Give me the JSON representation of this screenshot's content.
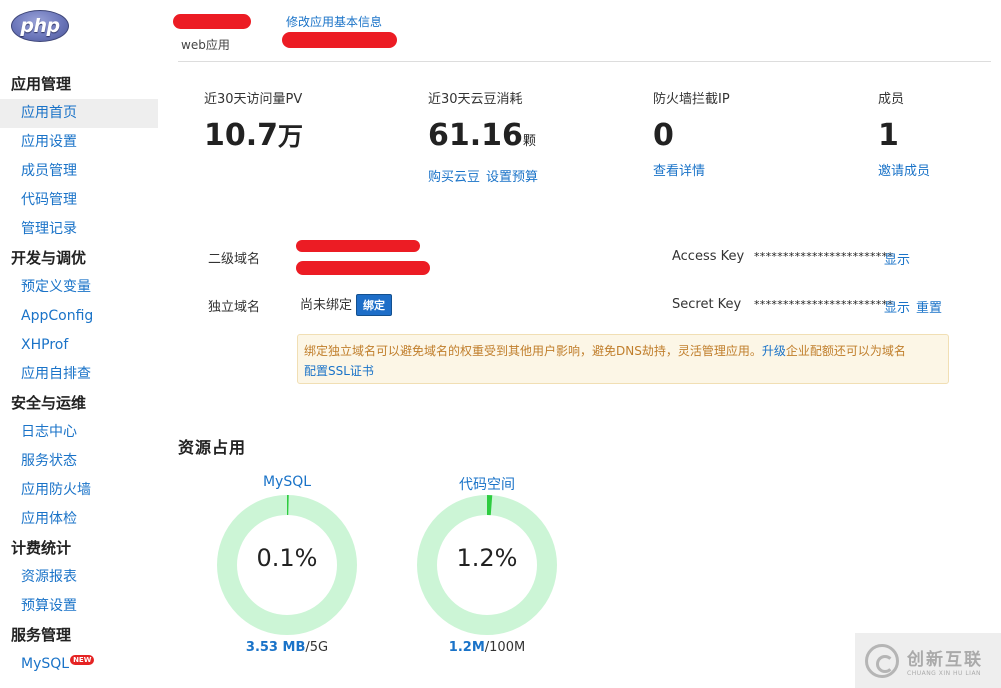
{
  "header": {
    "logo_text": "php",
    "app_type": "web应用",
    "edit_link": "修改应用基本信息"
  },
  "sidebar": {
    "groups": [
      {
        "title": "应用管理",
        "items": [
          "应用首页",
          "应用设置",
          "成员管理",
          "代码管理",
          "管理记录"
        ]
      },
      {
        "title": "开发与调优",
        "items": [
          "预定义变量",
          "AppConfig",
          "XHProf",
          "应用自排查"
        ]
      },
      {
        "title": "安全与运维",
        "items": [
          "日志中心",
          "服务状态",
          "应用防火墙",
          "应用体检"
        ]
      },
      {
        "title": "计费统计",
        "items": [
          "资源报表",
          "预算设置"
        ]
      },
      {
        "title": "服务管理",
        "items": [
          "MySQL"
        ]
      }
    ],
    "active_item": "应用首页",
    "new_badge": "NEW"
  },
  "stats": {
    "pv": {
      "label": "近30天访问量PV",
      "value": "10.7",
      "unit": "万"
    },
    "yundou": {
      "label": "近30天云豆消耗",
      "value": "61.16",
      "unit": "颗",
      "links": [
        "购买云豆",
        "设置预算"
      ]
    },
    "firewall": {
      "label": "防火墙拦截IP",
      "value": "0",
      "link": "查看详情"
    },
    "members": {
      "label": "成员",
      "value": "1",
      "link": "邀请成员"
    }
  },
  "domain": {
    "second_level_label": "二级域名",
    "custom_label": "独立域名",
    "custom_status": "尚未绑定",
    "bind_button": "绑定",
    "access_key_label": "Access Key",
    "access_key_mask": "************************",
    "access_key_link": "显示",
    "secret_key_label": "Secret Key",
    "secret_key_mask": "************************",
    "secret_key_links": [
      "显示",
      "重置"
    ],
    "notice_text_1": "绑定独立域名可以避免域名的权重受到其他用户影响，避免DNS劫持，灵活管理应用。",
    "notice_link_1": "升级",
    "notice_text_2": "企业配额还可以为域名",
    "notice_link_2": "配置SSL证书"
  },
  "resources": {
    "title": "资源占用",
    "gauges": [
      {
        "name": "MySQL",
        "percent": 0.1,
        "percent_label": "0.1%",
        "used": "3.53 MB",
        "total": "/5G"
      },
      {
        "name": "代码空间",
        "percent": 1.2,
        "percent_label": "1.2%",
        "used": "1.2M",
        "total": "/100M"
      }
    ],
    "colors": {
      "track": "#ccf5d6",
      "fill": "#2ecc40"
    }
  },
  "watermark": {
    "main": "创新互联",
    "sub": "CHUANG XIN HU LIAN"
  }
}
